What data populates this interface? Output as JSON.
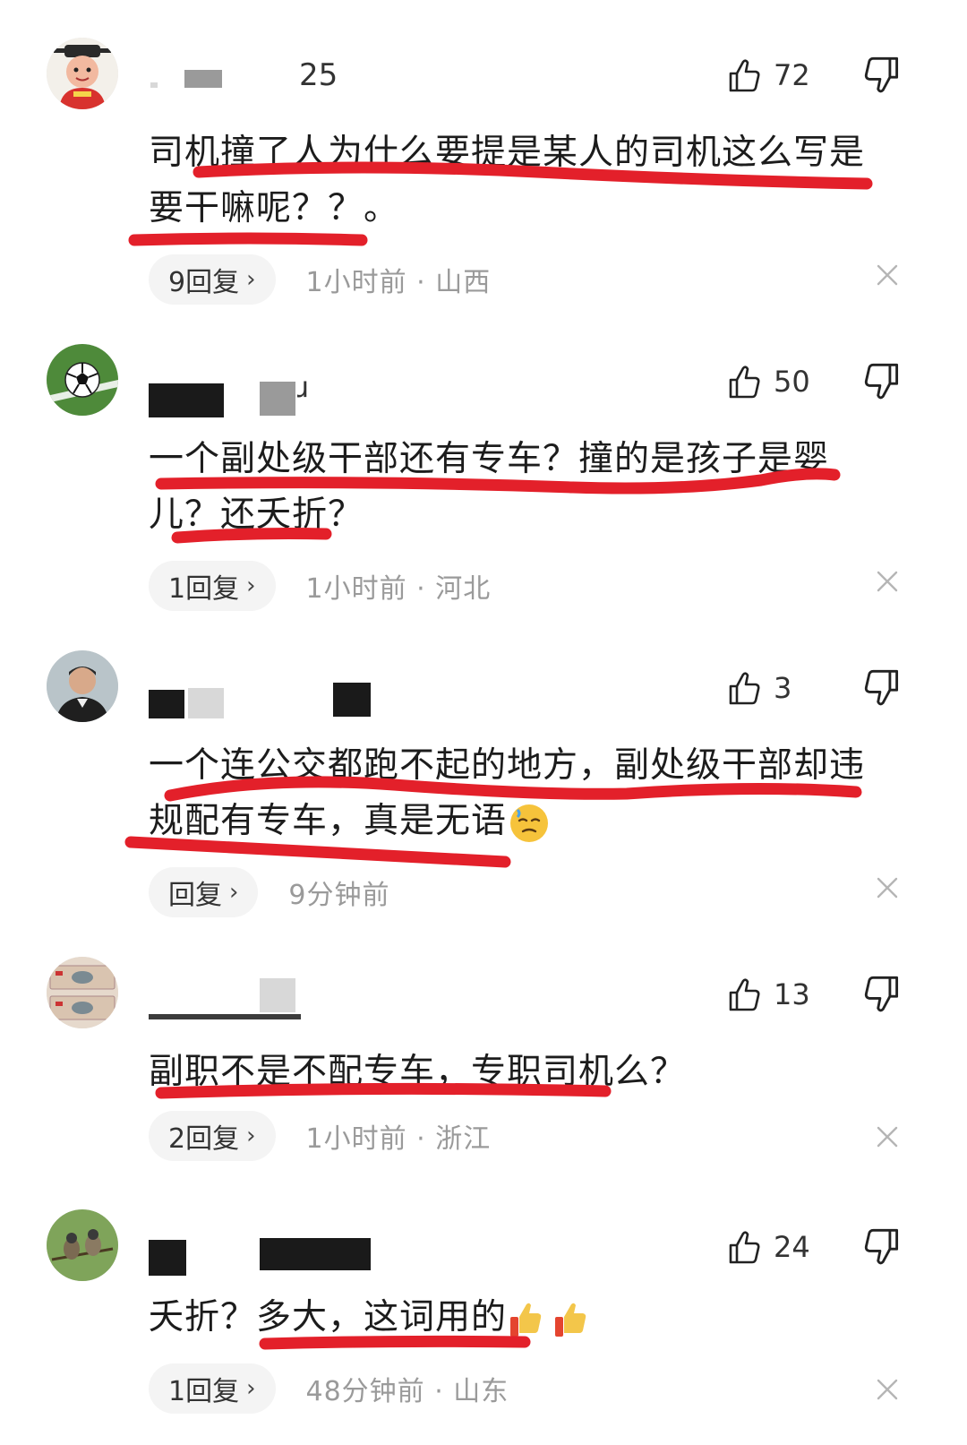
{
  "colors": {
    "underline": "#e3202a",
    "meta_text": "#9a9a9a",
    "pill_bg": "#f4f4f4"
  },
  "comments": [
    {
      "username": "25",
      "likes": "72",
      "lines": [
        "司机撞了人为什么要提是某人的司机这么写是",
        "要干嘛呢？？。"
      ],
      "reply": "9回复",
      "meta": "1小时前 · 山西",
      "avatar_icon": "cartoon-official-avatar"
    },
    {
      "username": "ɹ",
      "likes": "50",
      "lines": [
        "一个副处级干部还有专车？撞的是孩子是婴",
        "儿？还夭折？"
      ],
      "reply": "1回复",
      "meta": "1小时前 · 河北",
      "avatar_icon": "soccer-ball-avatar"
    },
    {
      "username": "",
      "likes": "3",
      "lines": [
        "一个连公交都跑不起的地方，副处级干部却违",
        "规配有专车，真是无语"
      ],
      "reply": "回复",
      "meta": "9分钟前",
      "avatar_icon": "man-portrait-avatar"
    },
    {
      "username": "",
      "likes": "13",
      "lines": [
        "副职不是不配专车，专职司机么？"
      ],
      "reply": "2回复",
      "meta": "1小时前 · 浙江",
      "avatar_icon": "banknote-avatar"
    },
    {
      "username": "",
      "likes": "24",
      "lines": [
        "夭折？多大，这词用的"
      ],
      "reply": "1回复",
      "meta": "48分钟前 · 山东",
      "avatar_icon": "birds-avatar"
    }
  ]
}
